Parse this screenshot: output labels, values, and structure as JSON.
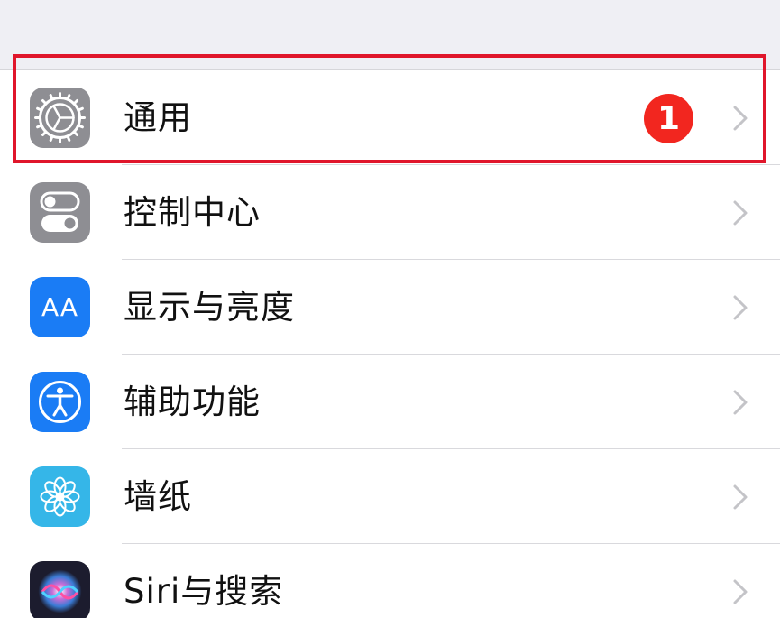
{
  "settings": {
    "items": [
      {
        "label": "通用",
        "icon": "gear-icon",
        "icon_bg": "#8e8e93",
        "badge": "1"
      },
      {
        "label": "控制中心",
        "icon": "toggles-icon",
        "icon_bg": "#8e8e93"
      },
      {
        "label": "显示与亮度",
        "icon": "text-size-icon",
        "icon_bg": "#1a7cf5",
        "icon_text": "AA"
      },
      {
        "label": "辅助功能",
        "icon": "accessibility-icon",
        "icon_bg": "#1a7cf5"
      },
      {
        "label": "墙纸",
        "icon": "flower-icon",
        "icon_bg": "#35b6e8"
      },
      {
        "label": "Siri与搜索",
        "icon": "siri-icon",
        "icon_bg": "#1c1c2e"
      }
    ]
  },
  "colors": {
    "badge": "#f2261f",
    "highlight": "#e0162b",
    "chevron": "#c4c4c8"
  }
}
